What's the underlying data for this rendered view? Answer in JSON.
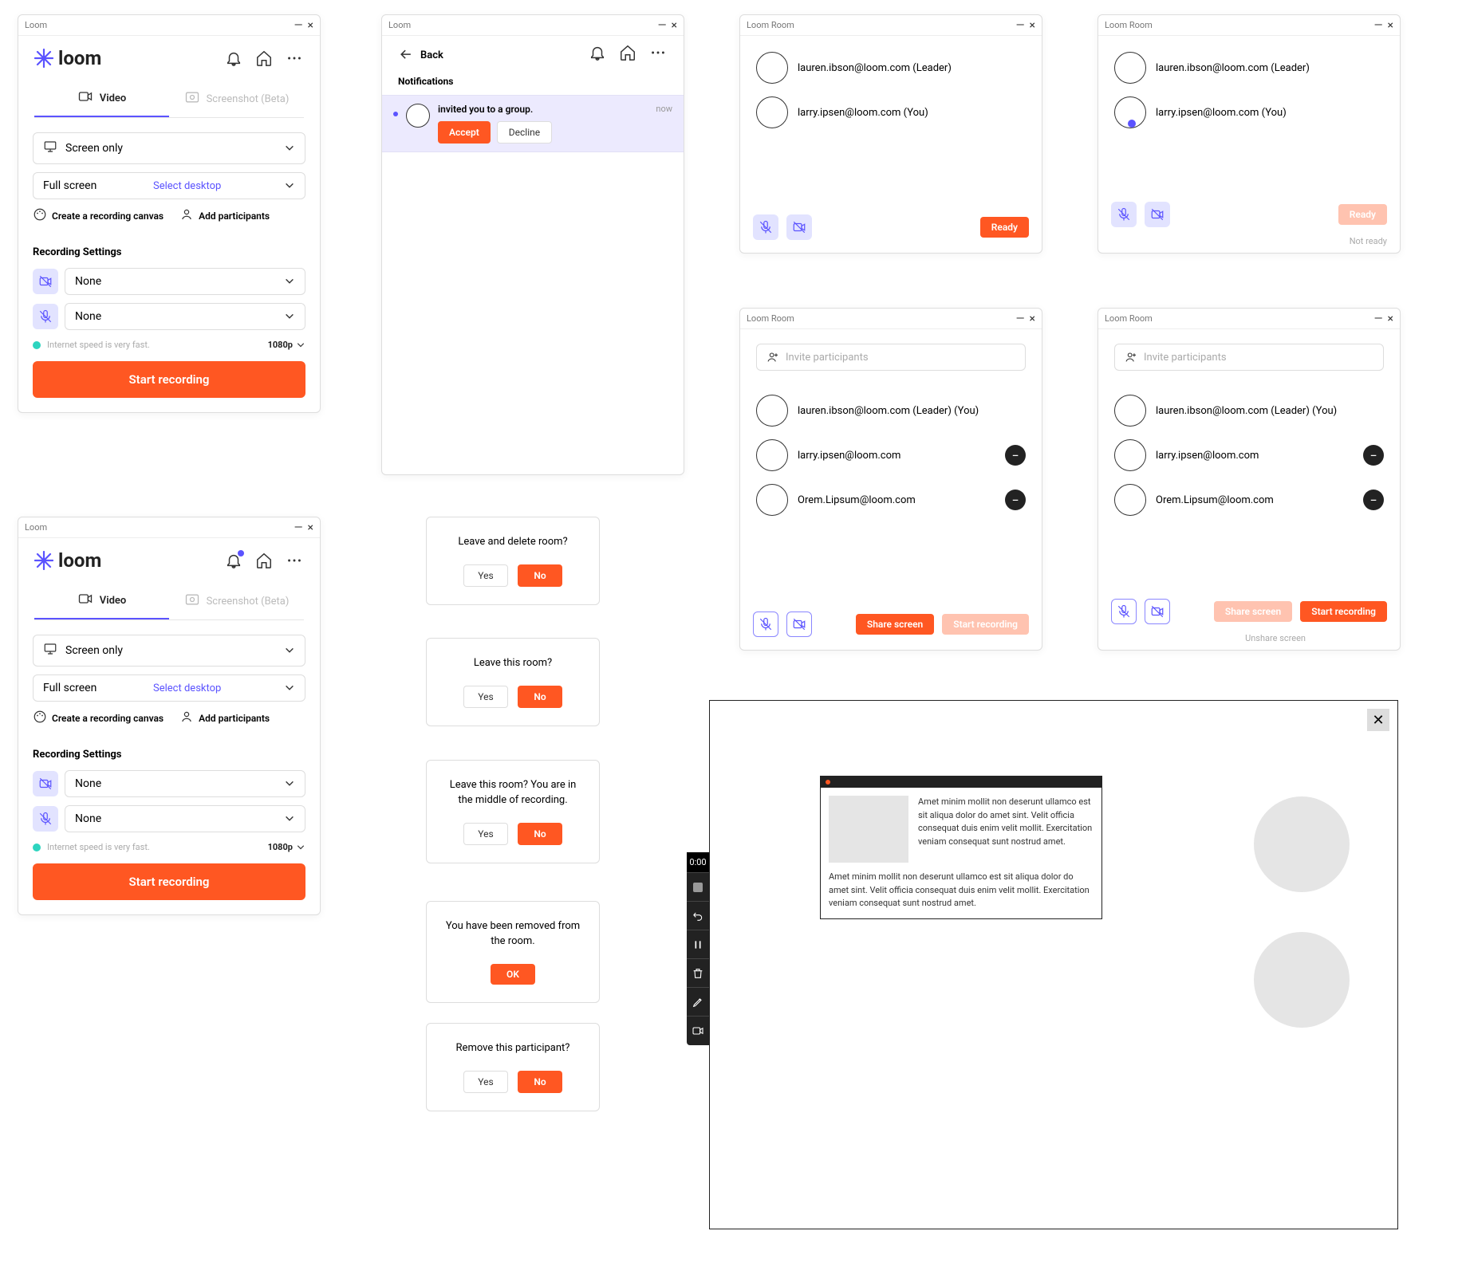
{
  "brand": "loom",
  "window": {
    "loom_title": "Loom",
    "room_title": "Loom Room"
  },
  "main": {
    "tabs": {
      "video": "Video",
      "screenshot": "Screenshot (Beta)"
    },
    "capture_mode": "Screen only",
    "display_mode": "Full screen",
    "select_desktop": "Select desktop",
    "create_canvas": "Create a recording canvas",
    "add_participants": "Add participants",
    "section_title": "Recording Settings",
    "camera_sel": "None",
    "mic_sel": "None",
    "net_status": "Internet speed is very fast.",
    "resolution": "1080p",
    "start_btn": "Start recording"
  },
  "notifications": {
    "back": "Back",
    "title": "Notifications",
    "message": "invited you to a group.",
    "time": "now",
    "accept": "Accept",
    "decline": "Decline"
  },
  "room": {
    "p1": "lauren.ibson@loom.com (Leader)",
    "p2": "larry.ipsen@loom.com (You)",
    "ready": "Ready",
    "not_ready": "Not ready",
    "invite_placeholder": "Invite participants",
    "p1_self": "lauren.ibson@loom.com (Leader) (You)",
    "p_larry": "larry.ipsen@loom.com",
    "p_orem": "Orem.Lipsum@loom.com",
    "share_screen": "Share screen",
    "unshare_screen": "Unshare screen",
    "start_recording": "Start recording"
  },
  "dialogs": {
    "d1": "Leave and delete room?",
    "d2": "Leave this room?",
    "d3": "Leave this room? You are in the middle of recording.",
    "d4": "You have been removed from the room.",
    "d5": "Remove this participant?",
    "yes": "Yes",
    "no": "No",
    "ok": "OK"
  },
  "recframe": {
    "timer": "0:00",
    "para1": "Amet minim mollit non deserunt ullamco est sit aliqua dolor do amet sint. Velit officia consequat duis enim velit mollit. Exercitation veniam consequat sunt nostrud amet.",
    "para2": "Amet minim mollit non deserunt ullamco est sit aliqua dolor do amet sint. Velit officia consequat duis enim velit mollit. Exercitation veniam consequat sunt nostrud amet."
  }
}
